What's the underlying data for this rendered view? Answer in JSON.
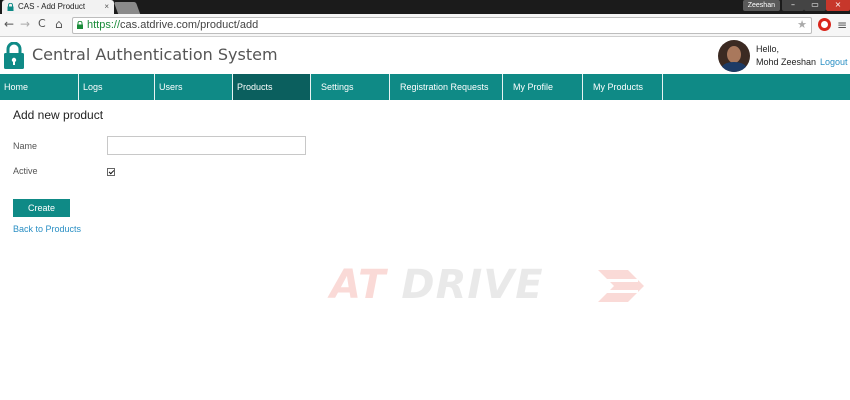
{
  "browser": {
    "tab_title": "CAS - Add Product",
    "tab_close": "×",
    "url_scheme": "https://",
    "url_rest": "cas.atdrive.com/product/add",
    "profile_name": "Zeeshan",
    "back_glyph": "←",
    "forward_glyph": "→",
    "reload_glyph": "C",
    "home_glyph": "⌂",
    "star_glyph": "★",
    "menu_glyph": "≡",
    "min_glyph": "–",
    "max_glyph": "▭",
    "close_glyph": "×",
    "extension_icon": "opera-icon"
  },
  "header": {
    "app_title": "Central Authentication System",
    "greeting": "Hello,",
    "user_name": "Mohd Zeeshan",
    "logout_label": "Logout",
    "logo_icon": "padlock-icon",
    "brand_color": "#0f8a86"
  },
  "nav": {
    "items": [
      {
        "label": "Home"
      },
      {
        "label": "Logs"
      },
      {
        "label": "Users"
      },
      {
        "label": "Products",
        "active": true
      },
      {
        "label": "Settings"
      },
      {
        "label": "Registration Requests (0)"
      },
      {
        "label": "My Profile"
      },
      {
        "label": "My Products"
      }
    ]
  },
  "form": {
    "title": "Add new product",
    "name_label": "Name",
    "name_value": "",
    "active_label": "Active",
    "active_checked": true,
    "create_label": "Create",
    "back_link_label": "Back to Products"
  },
  "watermark": {
    "text_at": "AT",
    "text_drive": "DRIVE",
    "accent_color": "#e53a2a"
  }
}
